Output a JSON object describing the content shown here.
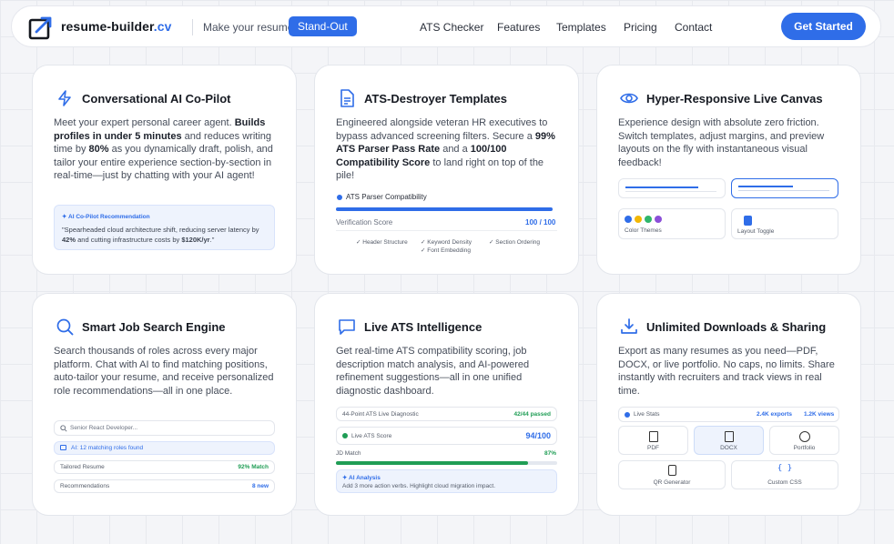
{
  "nav": {
    "brand_name": "resume-builder",
    "brand_tld": ".cv",
    "tagline": "Make your resume",
    "tag_pill": "Stand-Out",
    "links": [
      "ATS Checker",
      "Features",
      "Templates",
      "Pricing",
      "Contact"
    ],
    "cta": "Get Started"
  },
  "cards": {
    "copilot": {
      "title": "Conversational AI Co-Pilot",
      "desc_1": "Meet your expert personal career agent. ",
      "desc_b1": "Builds profiles in under 5 minutes",
      "desc_2": " and reduces writing time by ",
      "desc_b2": "80%",
      "desc_3": " as you dynamically draft, polish, and tailor your entire experience section-by-section in real-time—just by chatting with your AI agent!",
      "rec_label": "✦ AI Co-Pilot Recommendation",
      "rec_1": "\"Spearheaded cloud architecture shift, reducing server latency by ",
      "rec_b1": "42%",
      "rec_2": " and cutting infrastructure costs by ",
      "rec_b2": "$120K/yr",
      "rec_3": ".\""
    },
    "ats_templates": {
      "title": "ATS-Destroyer Templates",
      "desc_1": "Engineered alongside veteran HR executives to bypass advanced screening filters. Secure a ",
      "desc_b1": "99% ATS Parser Pass Rate",
      "desc_2": " and a ",
      "desc_b2": "100/100 Compatibility Score",
      "desc_3": " to land right on top of the pile!",
      "compat_label": "ATS Parser Compatibility",
      "compat_pct": 1.0,
      "verif_label": "Verification Score",
      "verif_value": "100 / 100",
      "checks": [
        "✓ Header Structure",
        "✓ Keyword Density",
        "✓ Section Ordering",
        "✓ Font Embedding"
      ]
    },
    "canvas": {
      "title": "Hyper-Responsive Live Canvas",
      "desc": "Experience design with absolute zero friction. Switch templates, adjust margins, and preview layouts on the fly with instantaneous visual feedback!",
      "color_themes": "Color Themes",
      "layout_toggle": "Layout Toggle",
      "theme_colors": [
        "#2f6de8",
        "#f2b705",
        "#2fb66b",
        "#8b4fd8"
      ]
    },
    "job_search": {
      "title": "Smart Job Search Engine",
      "desc": "Search thousands of roles across every major platform. Chat with AI to find matching positions, auto-tailor your resume, and receive personalized role recommendations—all in one place.",
      "search_placeholder": "Senior React Developer...",
      "ai_found": "AI: 12 matching roles found",
      "tailored_label": "Tailored Resume",
      "tailored_value": "92% Match",
      "recs_label": "Recommendations",
      "recs_value": "8 new"
    },
    "live_ats": {
      "title": "Live ATS Intelligence",
      "desc": "Get real-time ATS compatibility scoring, job description match analysis, and AI-powered refinement suggestions—all in one unified diagnostic dashboard.",
      "diag_label": "44-Point ATS Live Diagnostic",
      "diag_value": "42/44 passed",
      "score_label": "Live ATS Score",
      "score_value": "94/100",
      "jd_label": "JD Match",
      "jd_value": "87%",
      "jd_pct": 0.87,
      "analysis_label": "✦ AI Analysis",
      "analysis_text": "Add 3 more action verbs. Highlight cloud migration impact."
    },
    "downloads": {
      "title": "Unlimited Downloads & Sharing",
      "desc": "Export as many resumes as you need—PDF, DOCX, or live portfolio. No caps, no limits. Share instantly with recruiters and track views in real time.",
      "stats_label": "Live Stats",
      "exports": "2.4K exports",
      "views": "1.2K views",
      "tiles": [
        "PDF",
        "DOCX",
        "Portfolio",
        "QR Generator",
        "Custom CSS"
      ]
    }
  },
  "colors": {
    "accent": "#2f6de8",
    "success": "#1f9d55"
  }
}
